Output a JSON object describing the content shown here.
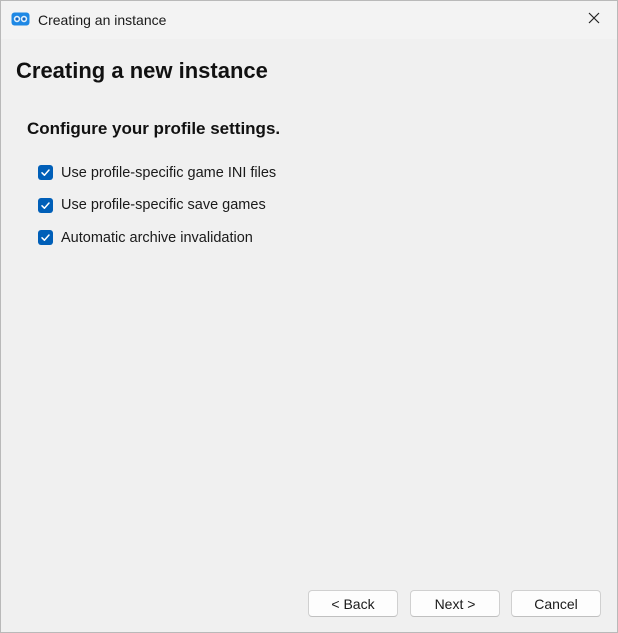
{
  "window": {
    "title": "Creating an instance"
  },
  "page": {
    "heading": "Creating a new instance",
    "section_heading": "Configure your profile settings."
  },
  "options": [
    {
      "label": "Use profile-specific game INI files",
      "checked": true
    },
    {
      "label": "Use profile-specific save games",
      "checked": true
    },
    {
      "label": "Automatic archive invalidation",
      "checked": true
    }
  ],
  "buttons": {
    "back": "< Back",
    "next": "Next >",
    "cancel": "Cancel"
  },
  "colors": {
    "accent": "#005fb8",
    "app_icon": "#1e88e5"
  }
}
